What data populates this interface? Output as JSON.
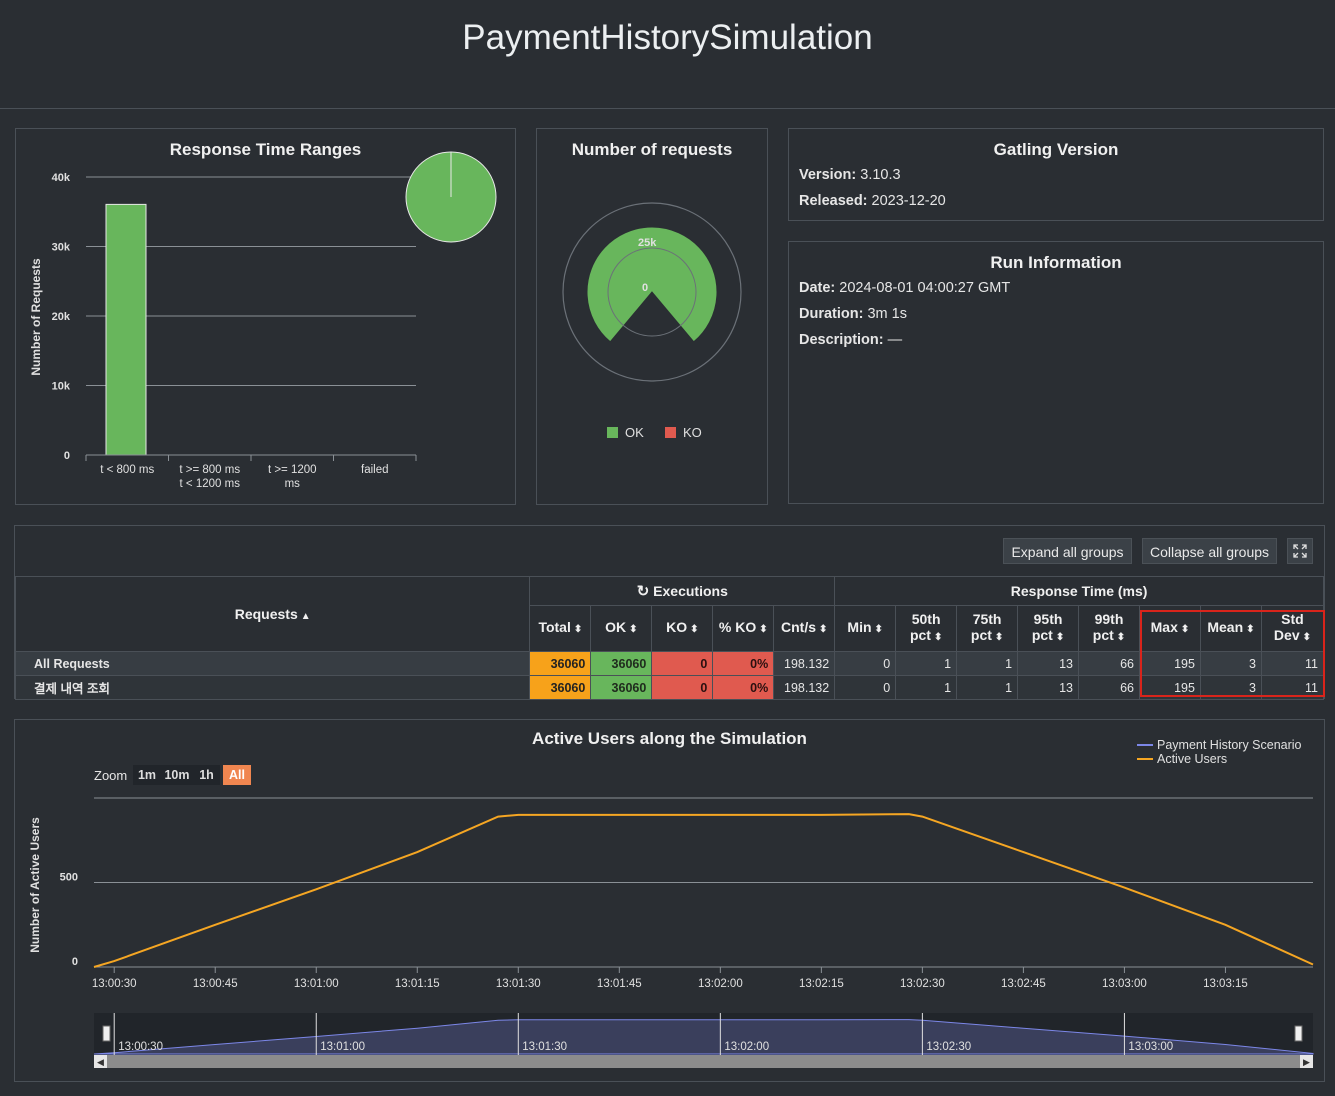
{
  "page": {
    "title": "PaymentHistorySimulation"
  },
  "response_time_ranges": {
    "title": "Response Time Ranges",
    "ylabel": "Number of Requests",
    "ticks": [
      "0",
      "10k",
      "20k",
      "30k",
      "40k"
    ],
    "categories": [
      [
        "t < 800 ms"
      ],
      [
        "t >= 800 ms",
        "t < 1200 ms"
      ],
      [
        "t >= 1200",
        "ms"
      ],
      [
        "failed"
      ]
    ]
  },
  "number_of_requests": {
    "title": "Number of requests",
    "inner_labels": [
      "25k",
      "0"
    ],
    "legend": [
      {
        "label": "OK",
        "color": "#68b65c"
      },
      {
        "label": "KO",
        "color": "#e05a4f"
      }
    ]
  },
  "gatling_version": {
    "title": "Gatling Version",
    "version_label": "Version:",
    "version_value": "3.10.3",
    "released_label": "Released:",
    "released_value": "2023-12-20"
  },
  "run_information": {
    "title": "Run Information",
    "date_label": "Date:",
    "date_value": "2024-08-01 04:00:27 GMT",
    "duration_label": "Duration:",
    "duration_value": "3m 1s",
    "description_label": "Description:",
    "description_value": "—"
  },
  "stats_toolbar": {
    "expand_label": "Expand all groups",
    "collapse_label": "Collapse all groups"
  },
  "stats_table": {
    "requests_header": "Requests",
    "executions_header": "Executions",
    "response_time_header": "Response Time (ms)",
    "columns": [
      "Total",
      "OK",
      "KO",
      "% KO",
      "Cnt/s",
      "Min",
      "50th pct",
      "75th pct",
      "95th pct",
      "99th pct",
      "Max",
      "Mean",
      "Std Dev"
    ],
    "rows": [
      {
        "name": "All Requests",
        "total": "36060",
        "ok": "36060",
        "ko": "0",
        "pct_ko": "0%",
        "cnt_s": "198.132",
        "min": "0",
        "p50": "1",
        "p75": "1",
        "p95": "13",
        "p99": "66",
        "max": "195",
        "mean": "3",
        "std": "11"
      },
      {
        "name": "결제 내역 조회",
        "total": "36060",
        "ok": "36060",
        "ko": "0",
        "pct_ko": "0%",
        "cnt_s": "198.132",
        "min": "0",
        "p50": "1",
        "p75": "1",
        "p95": "13",
        "p99": "66",
        "max": "195",
        "mean": "3",
        "std": "11"
      }
    ]
  },
  "active_users": {
    "title": "Active Users along the Simulation",
    "ylabel": "Number of Active Users",
    "zoom_label": "Zoom",
    "zoom_options": [
      "1m",
      "10m",
      "1h",
      "All"
    ],
    "zoom_selected": "All",
    "legend": [
      {
        "label": "Payment History Scenario",
        "color": "#7c87e8"
      },
      {
        "label": "Active Users",
        "color": "#f5a623"
      }
    ],
    "y_ticks": [
      "0",
      "500"
    ],
    "x_ticks": [
      "13:00:30",
      "13:00:45",
      "13:01:00",
      "13:01:15",
      "13:01:30",
      "13:01:45",
      "13:02:00",
      "13:02:15",
      "13:02:30",
      "13:02:45",
      "13:03:00",
      "13:03:15"
    ],
    "navigator_ticks": [
      "13:00:30",
      "13:01:00",
      "13:01:30",
      "13:02:00",
      "13:02:30",
      "13:03:00"
    ]
  },
  "chart_data": [
    {
      "type": "bar",
      "title": "Response Time Ranges",
      "ylabel": "Number of Requests",
      "categories": [
        "t < 800 ms",
        "t >= 800 ms t < 1200 ms",
        "t >= 1200 ms",
        "failed"
      ],
      "values": [
        36060,
        0,
        0,
        0
      ],
      "ylim": [
        0,
        40000
      ]
    },
    {
      "type": "pie",
      "title": "Number of requests",
      "categories": [
        "OK",
        "KO"
      ],
      "values": [
        36060,
        0
      ]
    },
    {
      "type": "line",
      "title": "Active Users along the Simulation",
      "ylabel": "Number of Active Users",
      "ylim": [
        0,
        1000
      ],
      "x": [
        "13:00:27",
        "13:00:30",
        "13:00:45",
        "13:01:00",
        "13:01:15",
        "13:01:27",
        "13:01:30",
        "13:01:45",
        "13:02:00",
        "13:02:15",
        "13:02:28",
        "13:02:30",
        "13:02:45",
        "13:03:00",
        "13:03:15",
        "13:03:28"
      ],
      "series": [
        {
          "name": "Active Users",
          "values": [
            0,
            35,
            250,
            460,
            680,
            890,
            900,
            900,
            900,
            900,
            905,
            890,
            680,
            470,
            250,
            15
          ]
        }
      ]
    }
  ]
}
